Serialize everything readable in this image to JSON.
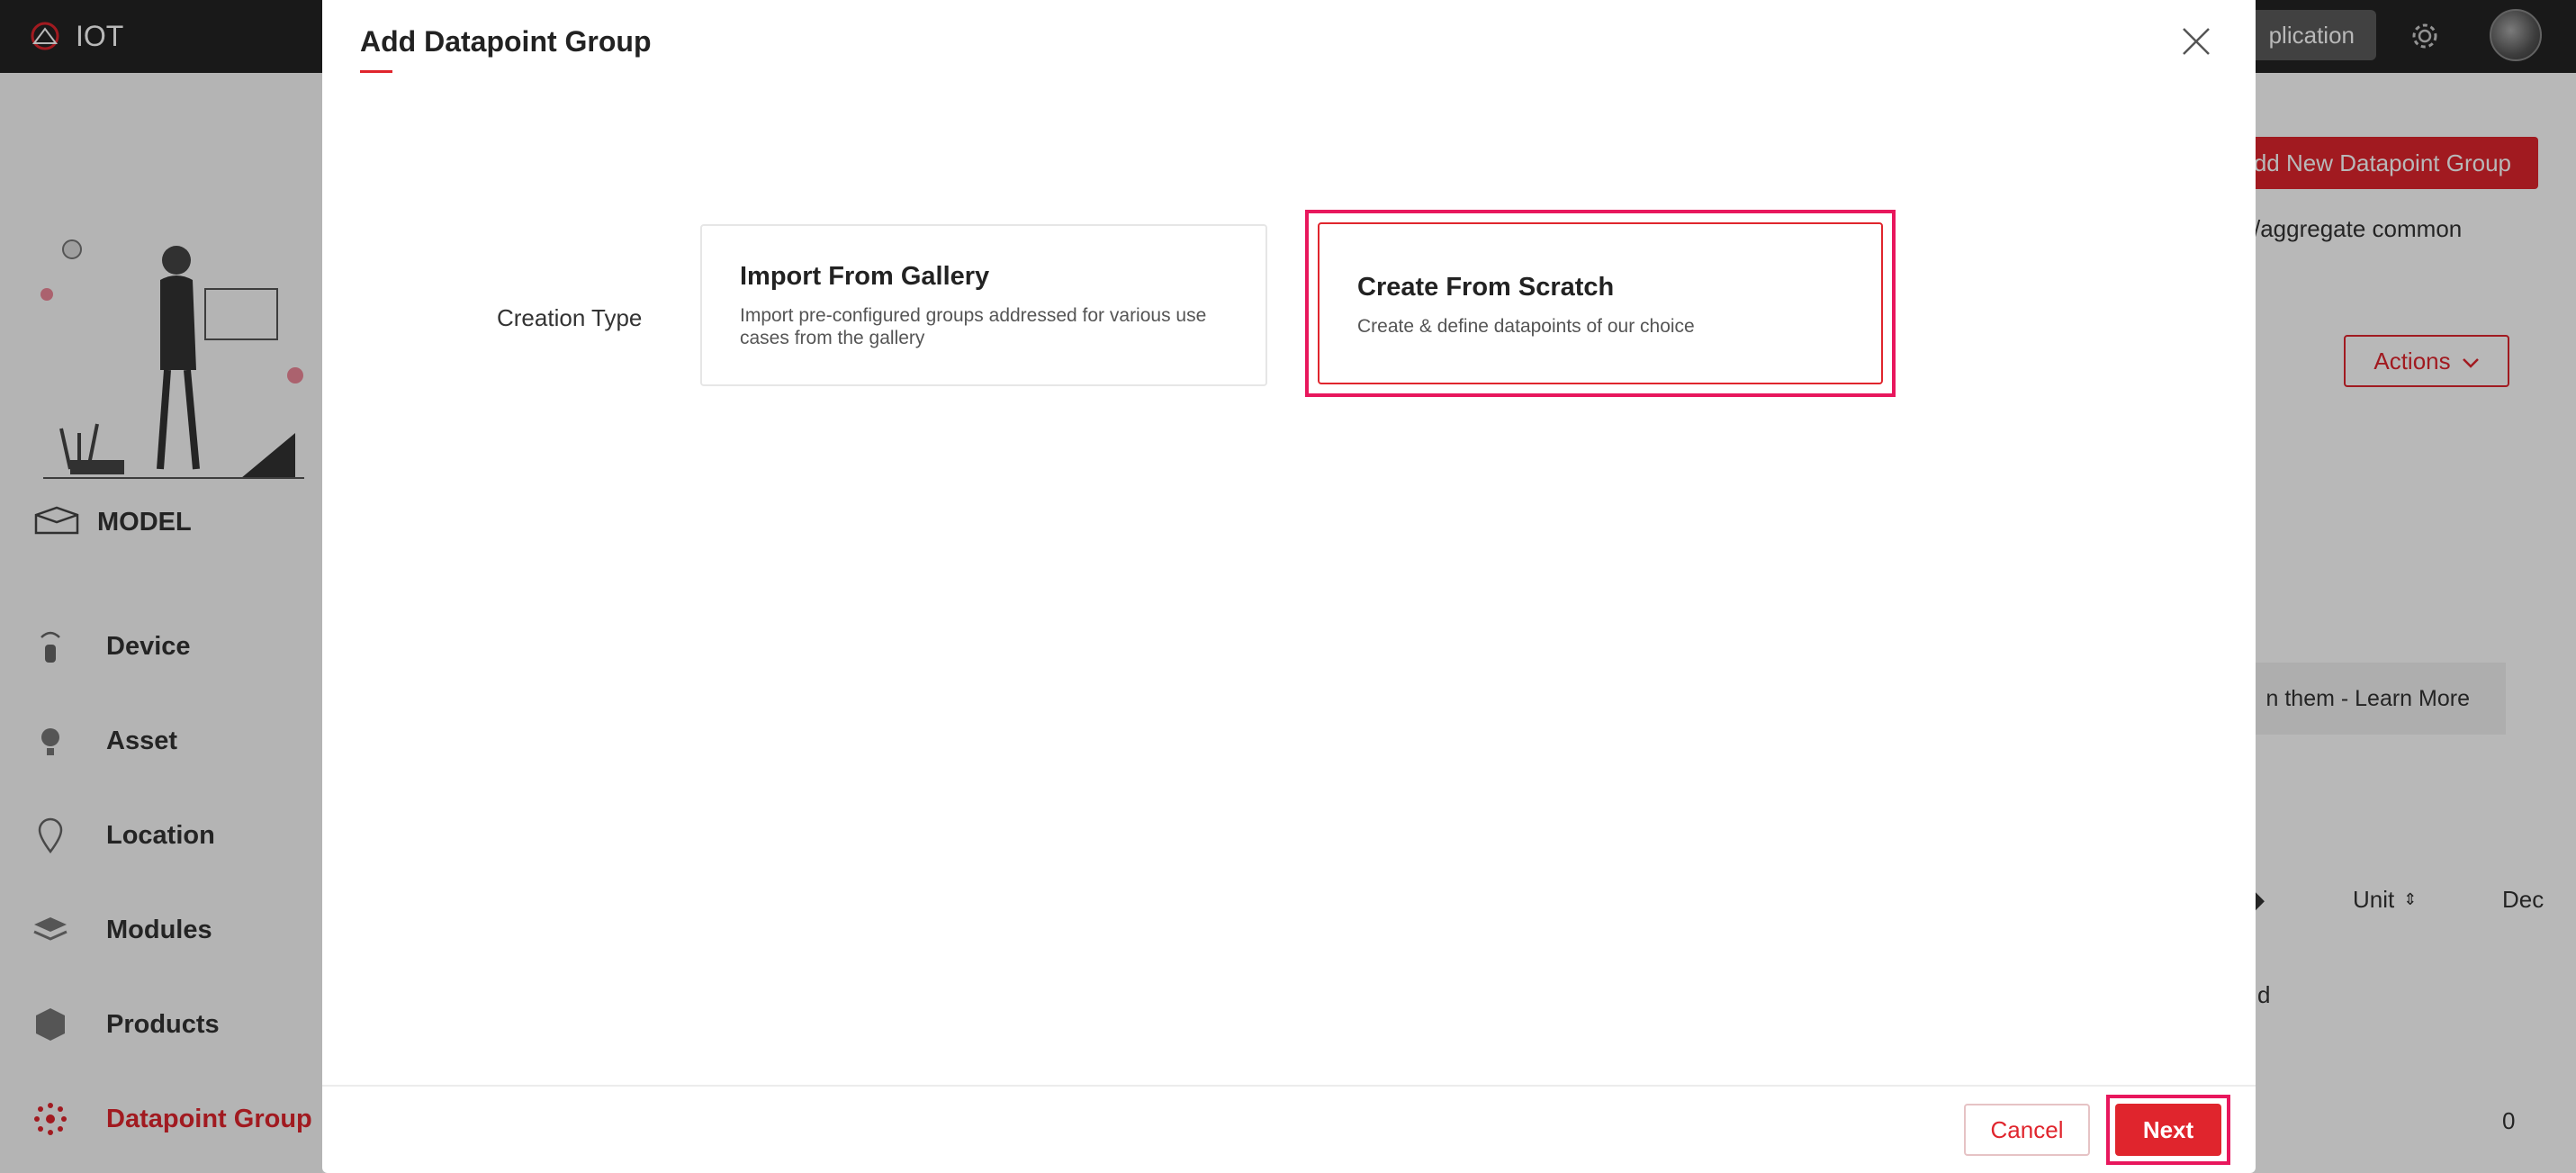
{
  "topbar": {
    "app_name": "IOT",
    "application_button": "plication"
  },
  "sidebar": {
    "section_title": "MODEL",
    "items": [
      {
        "label": "Device",
        "icon": "device-icon"
      },
      {
        "label": "Asset",
        "icon": "bulb-icon"
      },
      {
        "label": "Location",
        "icon": "location-pin-icon"
      },
      {
        "label": "Modules",
        "icon": "layers-icon"
      },
      {
        "label": "Products",
        "icon": "box-icon"
      },
      {
        "label": "Datapoint Group",
        "icon": "datapoint-icon",
        "active": true
      }
    ]
  },
  "background": {
    "add_new_button": "dd New Datapoint Group",
    "description_fragment": "/aggregate common",
    "actions_button": "Actions",
    "info_fragment": "n them - Learn More",
    "table_headers": [
      "Unit",
      "Dec"
    ],
    "row_fragment": "d",
    "row_value": "0"
  },
  "modal": {
    "title": "Add Datapoint Group",
    "creation_type_label": "Creation Type",
    "options": [
      {
        "title": "Import From Gallery",
        "description": "Import pre-configured groups addressed for various use cases from the gallery"
      },
      {
        "title": "Create From Scratch",
        "description": "Create & define datapoints of our choice",
        "selected": true
      }
    ],
    "cancel_label": "Cancel",
    "next_label": "Next"
  },
  "colors": {
    "accent": "#e0252d",
    "highlight": "#e8175d",
    "topbar": "#232323"
  }
}
